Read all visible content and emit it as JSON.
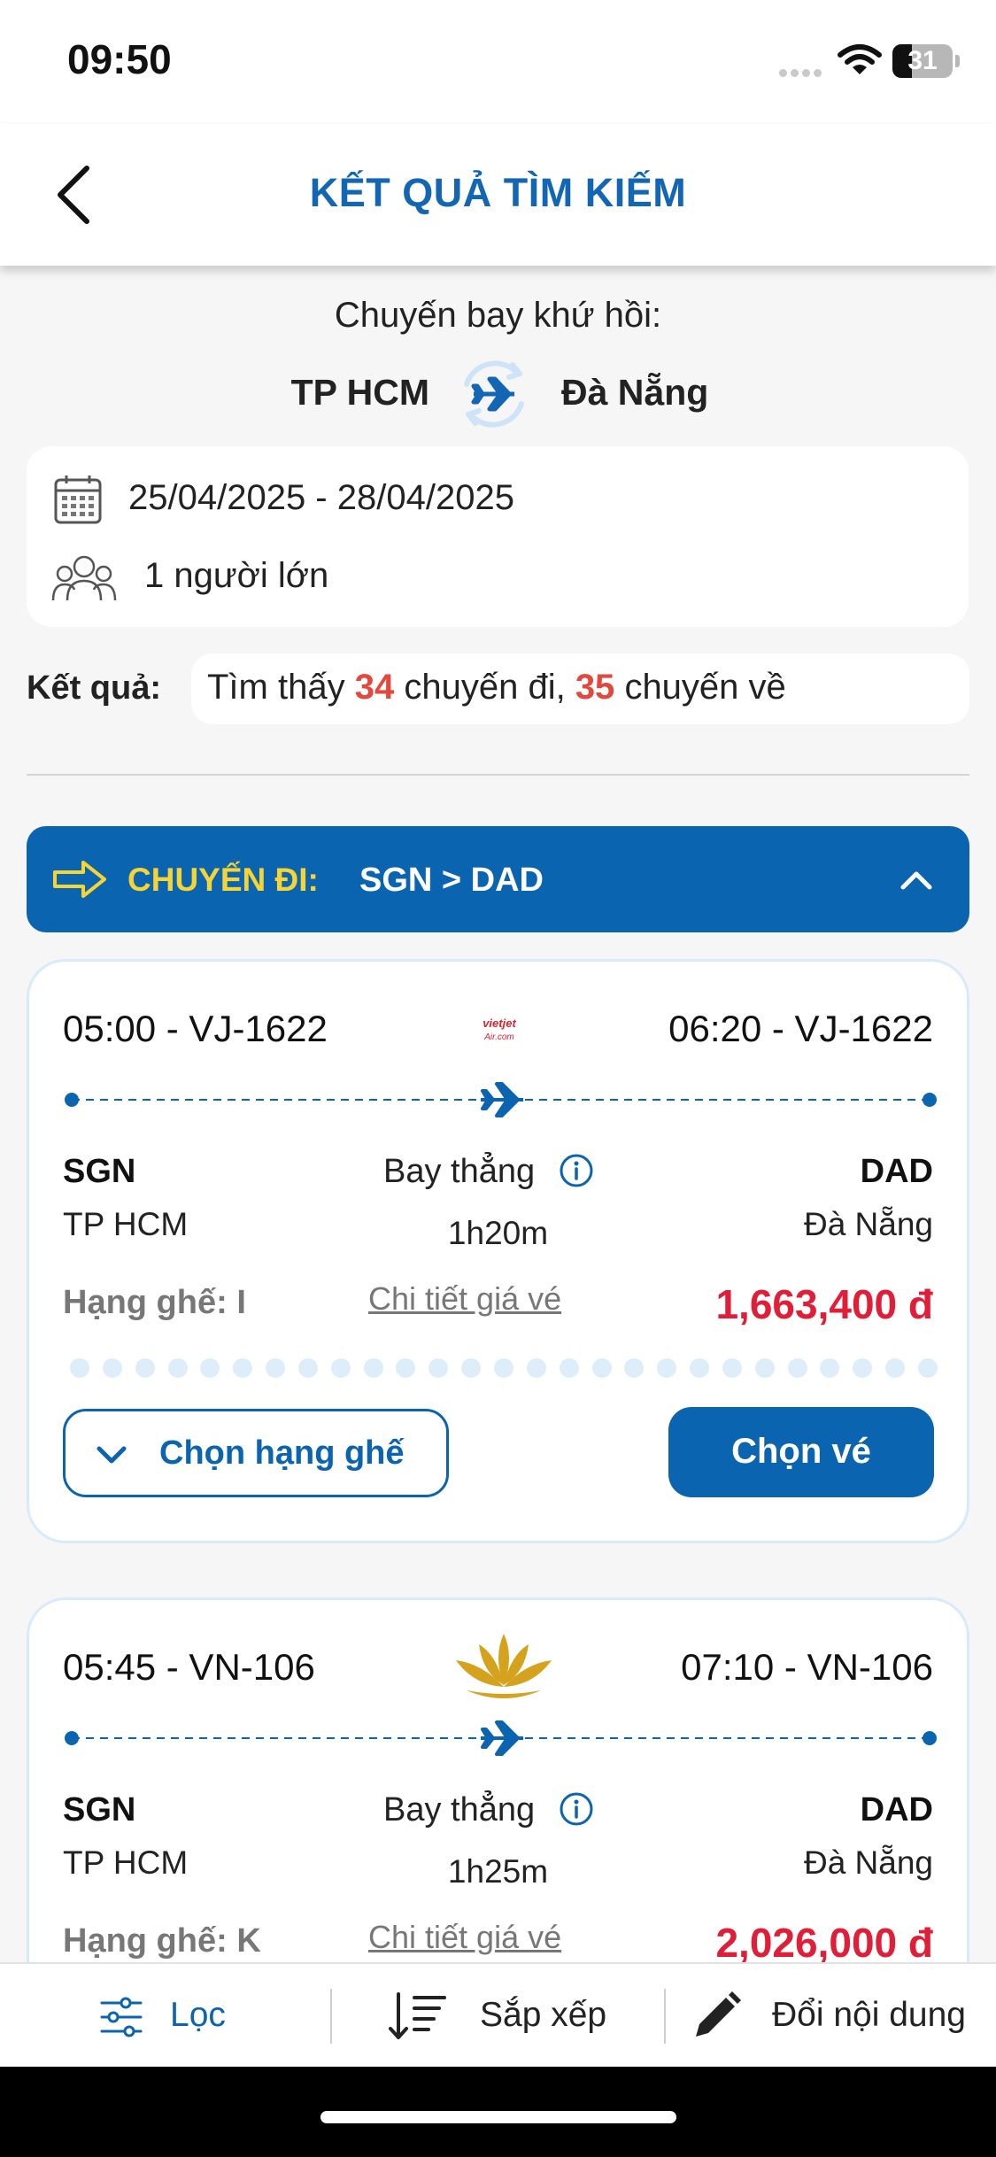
{
  "status_bar": {
    "time": "09:50",
    "battery": "31"
  },
  "header": {
    "title": "KẾT QUẢ TÌM KIẾM"
  },
  "search": {
    "trip_type": "Chuyến bay khứ hồi:",
    "from": "TP HCM",
    "to": "Đà Nẵng",
    "dates": "25/04/2025 - 28/04/2025",
    "passengers": "1 người lớn"
  },
  "results": {
    "label": "Kết quả:",
    "prefix": "Tìm thấy",
    "outbound_count": "34",
    "middle": "chuyến đi,",
    "return_count": "35",
    "suffix": "chuyến về"
  },
  "leg": {
    "label": "CHUYẾN ĐI:",
    "route": "SGN > DAD"
  },
  "flights": [
    {
      "departure": "05:00 - VJ-1622",
      "arrival": "06:20 - VJ-1622",
      "airline_logo": "vietjet-logo",
      "logo_text": "vietjet Air.com",
      "from_code": "SGN",
      "from_city": "TP HCM",
      "to_code": "DAD",
      "to_city": "Đà Nẵng",
      "stop": "Bay thẳng",
      "duration": "1h20m",
      "seat_class": "Hạng ghế: I",
      "fare_detail": "Chi tiết giá vé",
      "price": "1,663,400 đ",
      "choose_class": "Chọn hạng ghế",
      "choose_ticket": "Chọn vé"
    },
    {
      "departure": "05:45 - VN-106",
      "arrival": "07:10 - VN-106",
      "airline_logo": "vietnam-airlines-lotus-logo",
      "from_code": "SGN",
      "from_city": "TP HCM",
      "to_code": "DAD",
      "to_city": "Đà Nẵng",
      "stop": "Bay thẳng",
      "duration": "1h25m",
      "seat_class": "Hạng ghế: K",
      "fare_detail": "Chi tiết giá vé",
      "price": "2,026,000 đ"
    }
  ],
  "toolbar": {
    "filter": "Lọc",
    "sort": "Sắp xếp",
    "edit": "Đổi nội dung"
  },
  "colors": {
    "primary": "#0b64b0",
    "price": "#e01e37",
    "accent_yellow": "#f5d433",
    "count_red": "#e2493c"
  }
}
